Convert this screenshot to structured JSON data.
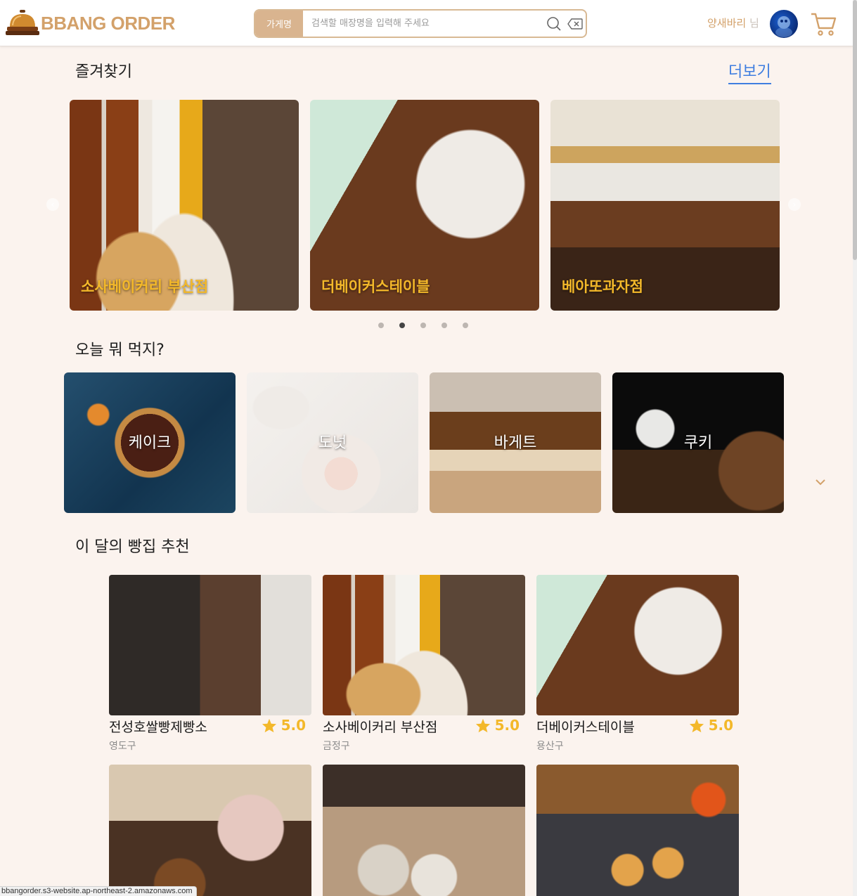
{
  "header": {
    "logo_text": "BBANG ORDER",
    "search_type_label": "가게명",
    "search_placeholder": "검색할 매장명을 입력해 주세요",
    "user_name": "양새바리",
    "user_suffix": "님"
  },
  "favorites": {
    "title": "즐겨찾기",
    "more_label": "더보기",
    "items": [
      {
        "name": "소사베이커리 부산점"
      },
      {
        "name": "더베이커스테이블"
      },
      {
        "name": "베아또과자점"
      }
    ],
    "dots_total": 5,
    "active_dot": 2
  },
  "today": {
    "title": "오늘 뭐 먹지?",
    "categories": [
      {
        "label": "케이크"
      },
      {
        "label": "도넛"
      },
      {
        "label": "바게트"
      },
      {
        "label": "쿠키"
      }
    ]
  },
  "recommend": {
    "title": "이 달의 빵집 추천",
    "items": [
      {
        "name": "전성호쌀빵제빵소",
        "rating": "5.0",
        "district": "영도구"
      },
      {
        "name": "소사베이커리 부산점",
        "rating": "5.0",
        "district": "금정구"
      },
      {
        "name": "더베이커스테이블",
        "rating": "5.0",
        "district": "용산구"
      },
      {
        "name": "",
        "rating": "",
        "district": ""
      },
      {
        "name": "",
        "rating": "",
        "district": ""
      },
      {
        "name": "",
        "rating": "",
        "district": ""
      }
    ]
  },
  "status_url": "bbangorder.s3-website.ap-northeast-2.amazonaws.com",
  "colors": {
    "accent": "#d3a16a",
    "link": "#3f7ee0",
    "star": "#f3b82a",
    "background": "#fbf3ee"
  }
}
